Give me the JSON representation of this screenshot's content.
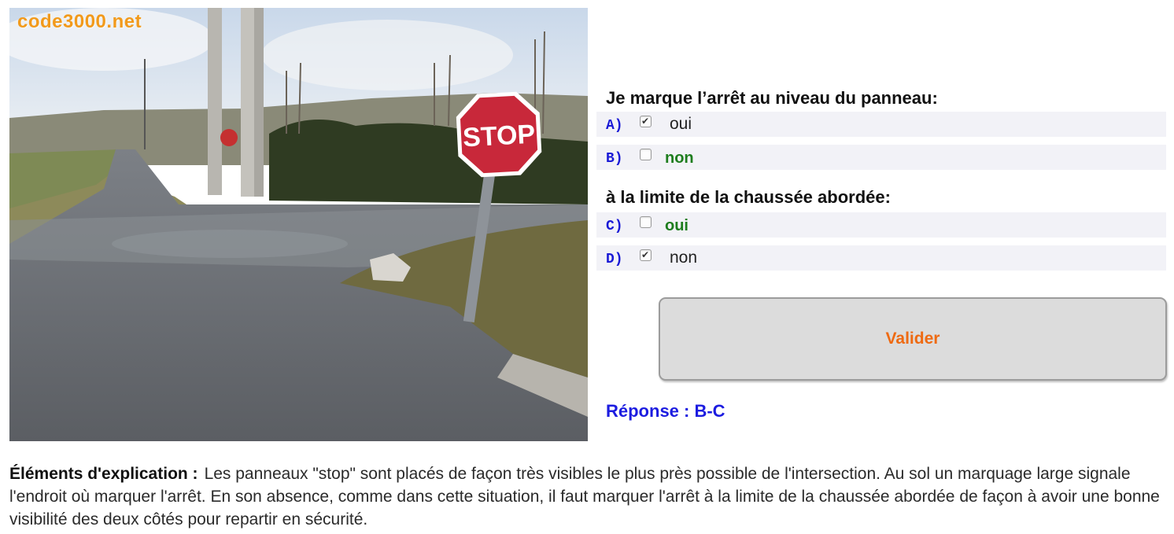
{
  "photo": {
    "watermark": "code3000.net",
    "sign_text": "STOP"
  },
  "question1": {
    "title": "Je marque l’arrêt au niveau du panneau:",
    "options": [
      {
        "letter": "A)",
        "text": "oui",
        "checked": true
      },
      {
        "letter": "B)",
        "text": "non",
        "checked": false
      }
    ]
  },
  "question2": {
    "title": "à la limite de la chaussée abordée:",
    "options": [
      {
        "letter": "C)",
        "text": "oui",
        "checked": false
      },
      {
        "letter": "D)",
        "text": "non",
        "checked": true
      }
    ]
  },
  "validate_label": "Valider",
  "response": "Réponse : B-C",
  "explanation": {
    "heading": "Éléments d'explication :",
    "text": "Les panneaux \"stop\" sont placés de façon très visibles le plus près possible de l'intersection. Au sol un marquage large signale l'endroit où marquer l'arrêt. En son absence, comme dans cette situation, il faut marquer l'arrêt à la limite de la chaussée abordée de façon à avoir une bonne visibilité des deux côtés pour repartir en sécurité."
  },
  "colors": {
    "letter": "#1a1ad6",
    "correct_option": "#1e7d1e",
    "validate_text": "#ee6a12",
    "response": "#1c1ce0",
    "watermark": "#f29a1b",
    "stop_sign": "#c8283a"
  }
}
